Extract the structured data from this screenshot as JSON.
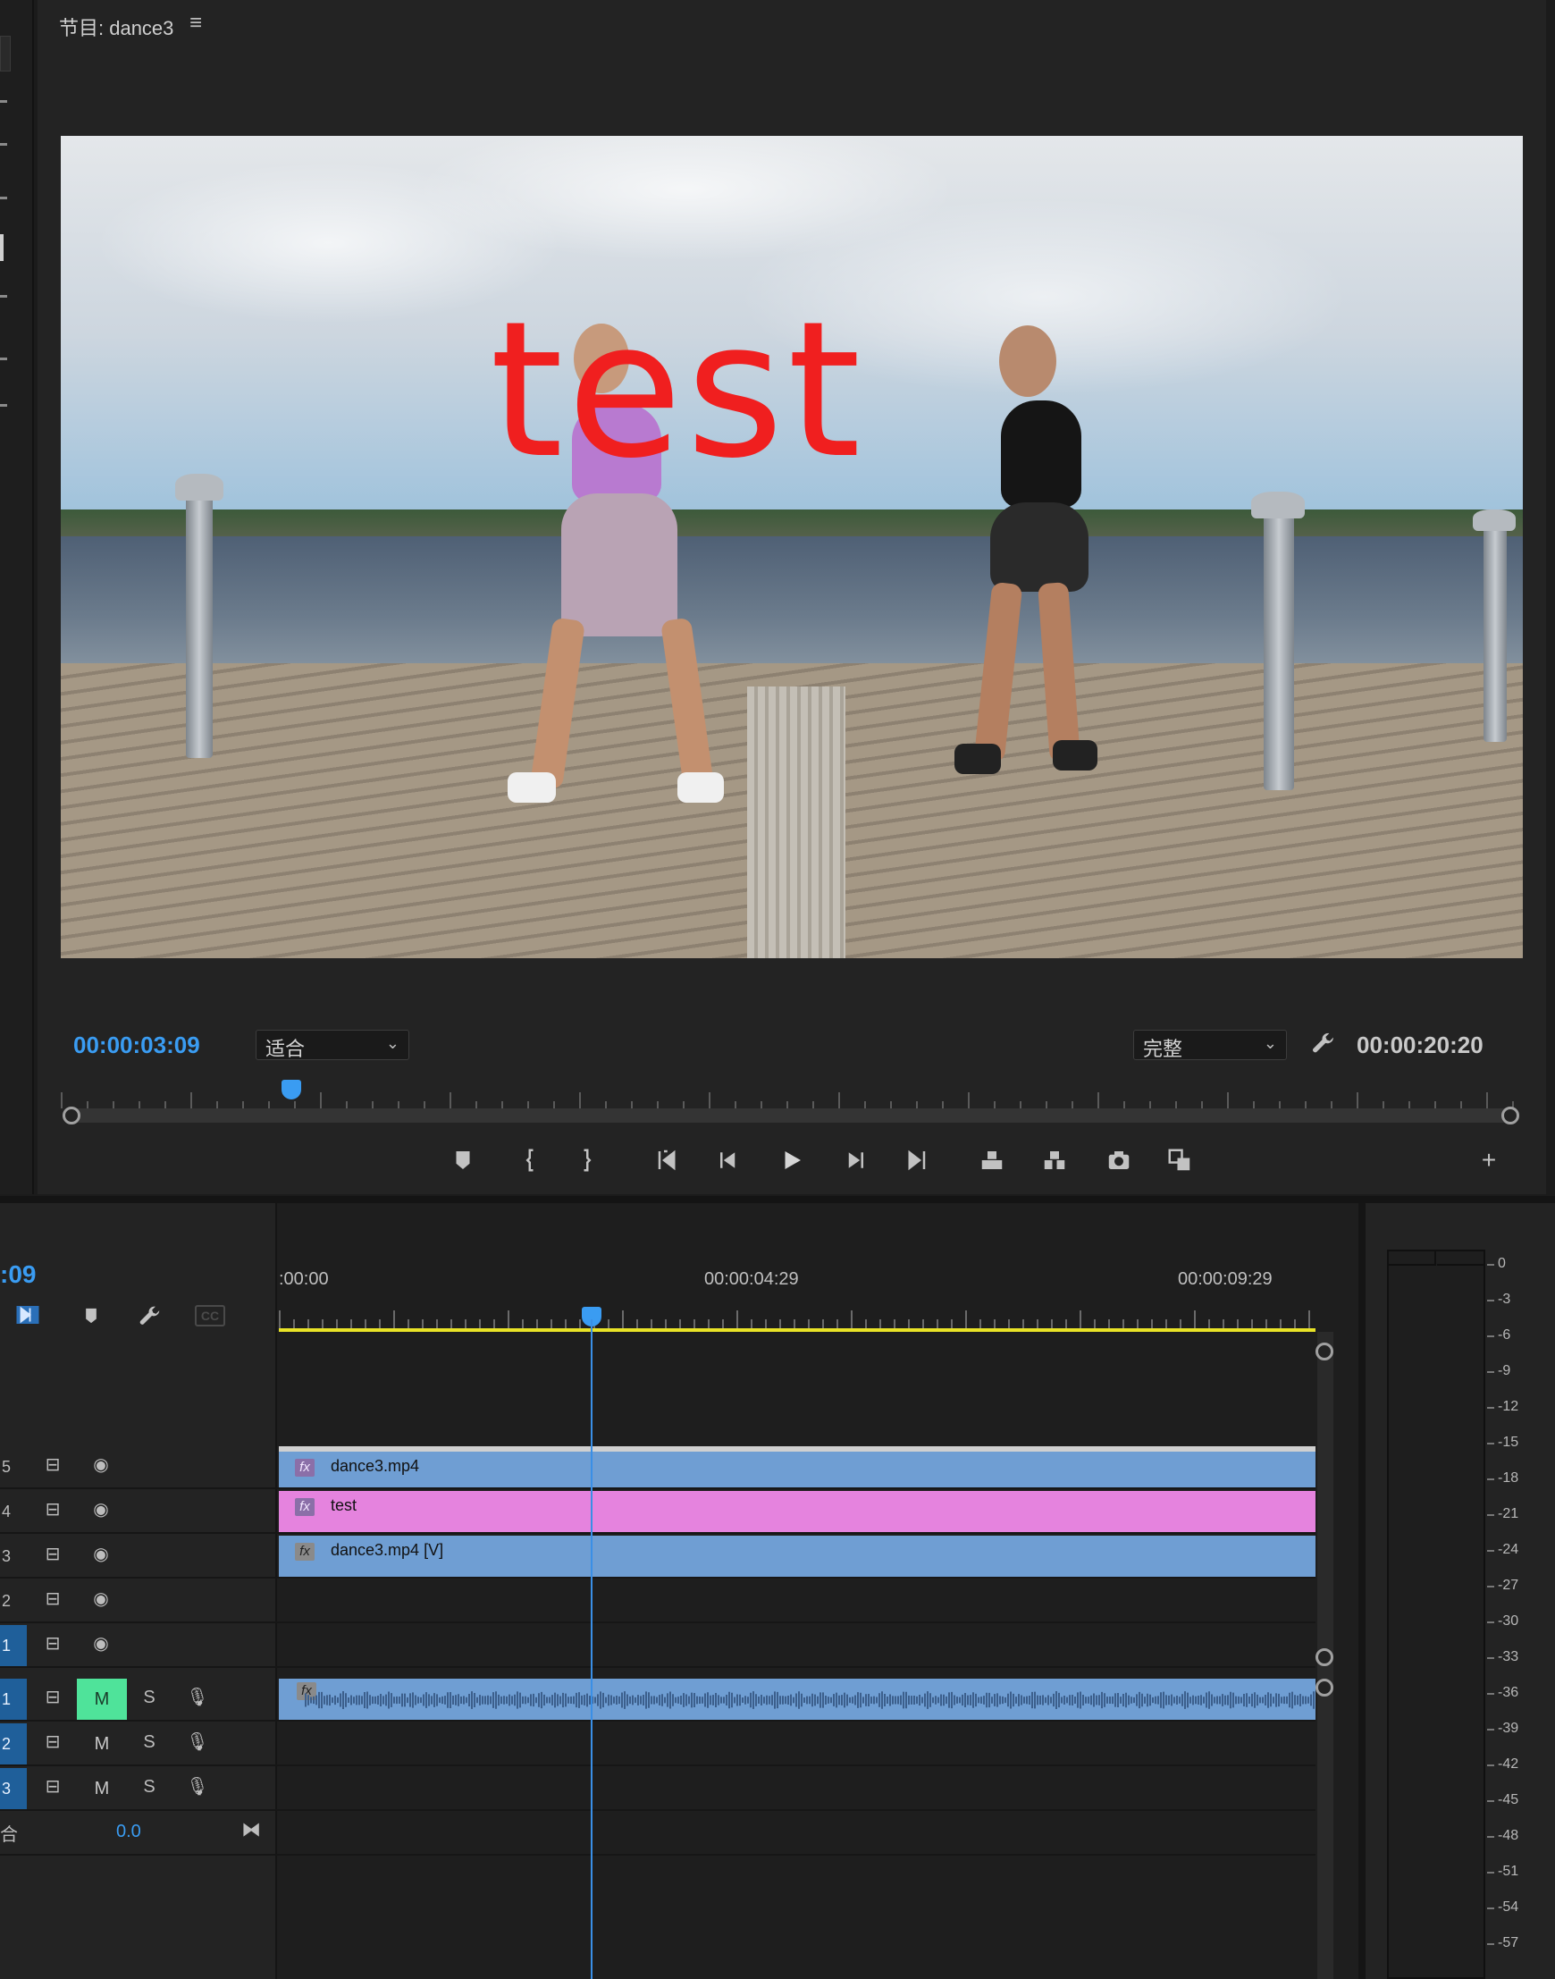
{
  "monitor": {
    "title": "节目: dance3",
    "menu_icon": "hamburger-icon",
    "overlay_text": "test",
    "current_time": "00:00:03:09",
    "fit_select": "适合",
    "quality_select": "完整",
    "duration": "00:00:20:20",
    "transport": [
      {
        "name": "add-marker",
        "icon": "marker-icon"
      },
      {
        "name": "mark-in",
        "icon": "mark-in-icon"
      },
      {
        "name": "mark-out",
        "icon": "mark-out-icon"
      },
      {
        "name": "go-to-in",
        "icon": "go-to-in-icon"
      },
      {
        "name": "step-back",
        "icon": "step-back-icon"
      },
      {
        "name": "play",
        "icon": "play-icon"
      },
      {
        "name": "step-forward",
        "icon": "step-forward-icon"
      },
      {
        "name": "go-to-out",
        "icon": "go-to-out-icon"
      },
      {
        "name": "lift",
        "icon": "lift-icon"
      },
      {
        "name": "extract",
        "icon": "extract-icon"
      },
      {
        "name": "export-frame",
        "icon": "camera-icon"
      },
      {
        "name": "comparison-view",
        "icon": "comparison-icon"
      },
      {
        "name": "button-editor",
        "icon": "plus-icon"
      }
    ]
  },
  "timeline": {
    "timecode_partial": ":09",
    "ruler": [
      ":00:00",
      "00:00:04:29",
      "00:00:09:29"
    ],
    "video_tracks": [
      {
        "label": "5",
        "clip": "dance3.mp4",
        "color": "#6f9ed3"
      },
      {
        "label": "4",
        "clip": "test",
        "color": "#e583de"
      },
      {
        "label": "3",
        "clip": "dance3.mp4 [V]",
        "color": "#6f9ed3"
      },
      {
        "label": "2",
        "clip": ""
      },
      {
        "label": "1",
        "clip": ""
      }
    ],
    "audio_tracks": [
      {
        "label": "1",
        "m": "M",
        "s": "S",
        "m_active": true
      },
      {
        "label": "2",
        "m": "M",
        "s": "S",
        "m_active": false
      },
      {
        "label": "3",
        "m": "M",
        "s": "S",
        "m_active": false
      }
    ],
    "mix_label": "合",
    "mix_value": "0.0",
    "playhead_color": "#3a8fe6",
    "work_area_color": "#e8e327"
  },
  "meter": {
    "scale": [
      "0",
      "-3",
      "-6",
      "-9",
      "-12",
      "-15",
      "-18",
      "-21",
      "-24",
      "-27",
      "-30",
      "-33",
      "-36",
      "-39",
      "-42",
      "-45",
      "-48",
      "-51",
      "-54",
      "-57"
    ]
  }
}
